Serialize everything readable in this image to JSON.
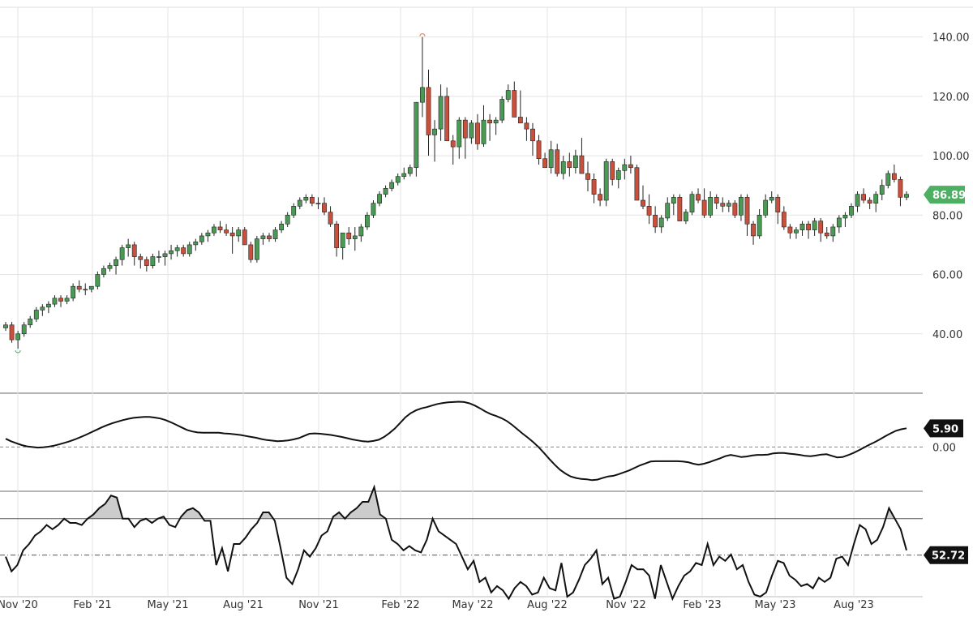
{
  "chart_data": [
    {
      "type": "candlestick",
      "panel": "price",
      "x_ticks": [
        "Nov '20",
        "Feb '21",
        "May '21",
        "Aug '21",
        "Nov '21",
        "Feb '22",
        "May '22",
        "Aug '22",
        "Nov '22",
        "Feb '23",
        "May '23",
        "Aug '23"
      ],
      "y_ticks": [
        "140.00",
        "120.00",
        "100.00",
        "80.00",
        "60.00",
        "40.00"
      ],
      "ylim": [
        20,
        150
      ],
      "grid": true,
      "last_price": "86.89",
      "colors": {
        "up": "#4a9a55",
        "down": "#c8503c",
        "last_badge": "#4caf61"
      },
      "ohlc": [
        [
          42,
          44,
          41,
          43
        ],
        [
          43,
          44,
          37,
          38
        ],
        [
          38,
          41,
          35,
          40
        ],
        [
          40,
          44,
          39,
          43
        ],
        [
          43,
          46,
          42,
          45
        ],
        [
          45,
          49,
          44,
          48
        ],
        [
          48,
          50,
          46,
          49
        ],
        [
          49,
          51,
          47,
          50
        ],
        [
          50,
          53,
          49,
          52
        ],
        [
          52,
          53,
          49,
          51
        ],
        [
          51,
          53,
          50,
          52
        ],
        [
          52,
          57,
          51,
          56
        ],
        [
          56,
          58,
          54,
          55
        ],
        [
          55,
          57,
          53,
          55
        ],
        [
          55,
          56,
          54,
          56
        ],
        [
          56,
          61,
          55,
          60
        ],
        [
          60,
          63,
          59,
          62
        ],
        [
          62,
          64,
          61,
          63
        ],
        [
          63,
          66,
          60,
          65
        ],
        [
          65,
          70,
          63,
          69
        ],
        [
          69,
          72,
          66,
          70
        ],
        [
          70,
          71,
          63,
          66
        ],
        [
          66,
          67,
          62,
          65
        ],
        [
          65,
          66,
          61,
          63
        ],
        [
          63,
          67,
          62,
          66
        ],
        [
          66,
          68,
          64,
          66
        ],
        [
          66,
          68,
          63,
          67
        ],
        [
          67,
          70,
          65,
          68
        ],
        [
          68,
          70,
          66,
          69
        ],
        [
          69,
          70,
          66,
          67
        ],
        [
          67,
          71,
          66,
          70
        ],
        [
          70,
          72,
          68,
          71
        ],
        [
          71,
          74,
          70,
          73
        ],
        [
          73,
          75,
          71,
          74
        ],
        [
          74,
          77,
          73,
          76
        ],
        [
          76,
          78,
          74,
          75
        ],
        [
          75,
          77,
          73,
          74
        ],
        [
          74,
          76,
          67,
          73
        ],
        [
          73,
          76,
          71,
          75
        ],
        [
          75,
          76,
          70,
          70
        ],
        [
          70,
          71,
          64,
          65
        ],
        [
          65,
          73,
          64,
          72
        ],
        [
          72,
          74,
          70,
          73
        ],
        [
          73,
          74,
          71,
          72
        ],
        [
          72,
          76,
          71,
          75
        ],
        [
          75,
          78,
          74,
          77
        ],
        [
          77,
          81,
          76,
          80
        ],
        [
          80,
          84,
          79,
          83
        ],
        [
          83,
          86,
          82,
          85
        ],
        [
          85,
          87,
          84,
          86
        ],
        [
          86,
          87,
          83,
          84
        ],
        [
          84,
          86,
          82,
          84
        ],
        [
          84,
          86,
          80,
          81
        ],
        [
          81,
          83,
          76,
          77
        ],
        [
          77,
          78,
          66,
          69
        ],
        [
          69,
          73,
          65,
          74
        ],
        [
          74,
          76,
          70,
          72
        ],
        [
          72,
          76,
          68,
          73
        ],
        [
          73,
          77,
          71,
          76
        ],
        [
          76,
          81,
          75,
          80
        ],
        [
          80,
          85,
          79,
          84
        ],
        [
          84,
          88,
          83,
          87
        ],
        [
          87,
          90,
          86,
          89
        ],
        [
          89,
          92,
          88,
          91
        ],
        [
          91,
          94,
          90,
          93
        ],
        [
          93,
          96,
          92,
          94
        ],
        [
          94,
          97,
          93,
          96
        ],
        [
          96,
          110,
          93,
          118
        ],
        [
          118,
          140,
          113,
          123
        ],
        [
          123,
          129,
          100,
          107
        ],
        [
          107,
          112,
          98,
          109
        ],
        [
          109,
          124,
          105,
          120
        ],
        [
          120,
          123,
          105,
          105
        ],
        [
          105,
          107,
          97,
          103
        ],
        [
          103,
          113,
          99,
          112
        ],
        [
          112,
          113,
          99,
          106
        ],
        [
          106,
          112,
          104,
          111
        ],
        [
          111,
          114,
          102,
          104
        ],
        [
          104,
          117,
          103,
          112
        ],
        [
          112,
          114,
          105,
          111
        ],
        [
          111,
          113,
          107,
          112
        ],
        [
          112,
          120,
          111,
          119
        ],
        [
          119,
          124,
          118,
          122
        ],
        [
          122,
          125,
          113,
          113
        ],
        [
          113,
          122,
          111,
          111
        ],
        [
          111,
          113,
          105,
          109
        ],
        [
          109,
          111,
          100,
          105
        ],
        [
          105,
          107,
          97,
          99
        ],
        [
          99,
          101,
          96,
          96
        ],
        [
          96,
          105,
          94,
          102
        ],
        [
          102,
          104,
          93,
          94
        ],
        [
          94,
          100,
          92,
          98
        ],
        [
          98,
          101,
          93,
          96
        ],
        [
          96,
          102,
          94,
          100
        ],
        [
          100,
          106,
          94,
          94
        ],
        [
          94,
          98,
          88,
          92
        ],
        [
          92,
          94,
          84,
          87
        ],
        [
          87,
          89,
          83,
          85
        ],
        [
          85,
          99,
          83,
          98
        ],
        [
          98,
          99,
          90,
          92
        ],
        [
          92,
          96,
          89,
          95
        ],
        [
          95,
          99,
          92,
          97
        ],
        [
          97,
          100,
          94,
          96
        ],
        [
          96,
          97,
          85,
          85
        ],
        [
          85,
          90,
          82,
          83
        ],
        [
          83,
          87,
          77,
          80
        ],
        [
          80,
          83,
          74,
          76
        ],
        [
          76,
          80,
          74,
          79
        ],
        [
          79,
          86,
          78,
          84
        ],
        [
          84,
          87,
          80,
          86
        ],
        [
          86,
          87,
          78,
          78
        ],
        [
          78,
          82,
          77,
          81
        ],
        [
          81,
          88,
          80,
          87
        ],
        [
          87,
          89,
          84,
          85
        ],
        [
          85,
          89,
          79,
          80
        ],
        [
          80,
          88,
          79,
          86
        ],
        [
          86,
          87,
          82,
          84
        ],
        [
          84,
          86,
          81,
          83
        ],
        [
          83,
          85,
          81,
          84
        ],
        [
          84,
          85,
          79,
          80
        ],
        [
          80,
          87,
          78,
          86
        ],
        [
          86,
          87,
          73,
          77
        ],
        [
          77,
          78,
          70,
          73
        ],
        [
          73,
          82,
          72,
          80
        ],
        [
          80,
          87,
          79,
          85
        ],
        [
          85,
          88,
          84,
          86
        ],
        [
          86,
          87,
          77,
          81
        ],
        [
          81,
          83,
          75,
          76
        ],
        [
          76,
          77,
          72,
          74
        ],
        [
          74,
          76,
          72,
          75
        ],
        [
          75,
          78,
          73,
          77
        ],
        [
          77,
          78,
          72,
          75
        ],
        [
          75,
          79,
          73,
          78
        ],
        [
          78,
          79,
          71,
          74
        ],
        [
          74,
          76,
          72,
          73
        ],
        [
          73,
          77,
          71,
          76
        ],
        [
          76,
          80,
          74,
          79
        ],
        [
          79,
          81,
          76,
          80
        ],
        [
          80,
          84,
          79,
          83
        ],
        [
          83,
          88,
          81,
          87
        ],
        [
          87,
          89,
          84,
          85
        ],
        [
          85,
          86,
          82,
          84
        ],
        [
          84,
          88,
          81,
          87
        ],
        [
          87,
          92,
          85,
          90
        ],
        [
          90,
          95,
          89,
          94
        ],
        [
          94,
          97,
          91,
          92
        ],
        [
          92,
          93,
          83,
          86
        ],
        [
          86,
          88,
          85,
          87
        ]
      ]
    },
    {
      "type": "line",
      "panel": "oscillator",
      "last_value": "5.90",
      "zero_label": "0.00",
      "ylim": [
        -14,
        17
      ],
      "values": [
        2.6,
        1.8,
        1.2,
        0.6,
        0.2,
        0,
        -0.2,
        -0.1,
        0.1,
        0.4,
        0.8,
        1.3,
        1.8,
        2.4,
        3.1,
        3.8,
        4.6,
        5.4,
        6.2,
        6.9,
        7.5,
        8,
        8.5,
        8.9,
        9.2,
        9.4,
        9.5,
        9.5,
        9.3,
        9,
        8.5,
        7.8,
        7,
        6.2,
        5.4,
        4.9,
        4.6,
        4.5,
        4.5,
        4.5,
        4.5,
        4.3,
        4.2,
        4,
        3.8,
        3.5,
        3.2,
        2.9,
        2.5,
        2.2,
        2,
        1.8,
        1.9,
        2.1,
        2.4,
        2.8,
        3.5,
        4.2,
        4.3,
        4.2,
        4,
        3.8,
        3.5,
        3.2,
        2.8,
        2.4,
        2.1,
        1.8,
        1.7,
        1.9,
        2.3,
        3.2,
        4.4,
        5.8,
        7.6,
        9.4,
        10.7,
        11.6,
        12.2,
        12.6,
        13.1,
        13.6,
        13.9,
        14.1,
        14.2,
        14.3,
        14.2,
        13.8,
        13.1,
        12.2,
        11.2,
        10.4,
        9.8,
        9.1,
        8.2,
        7,
        5.6,
        4.2,
        2.9,
        1.5,
        -0.1,
        -1.9,
        -3.8,
        -5.6,
        -7.2,
        -8.4,
        -9.3,
        -9.8,
        -10.1,
        -10.2,
        -10.5,
        -10.3,
        -9.8,
        -9.3,
        -9.1,
        -8.6,
        -8,
        -7.4,
        -6.6,
        -5.8,
        -5.2,
        -4.6,
        -4.5,
        -4.5,
        -4.5,
        -4.5,
        -4.5,
        -4.6,
        -4.8,
        -5.3,
        -5.6,
        -5.3,
        -4.8,
        -4.2,
        -3.6,
        -2.9,
        -2.5,
        -2.8,
        -3.2,
        -3,
        -2.7,
        -2.5,
        -2.5,
        -2.4,
        -2,
        -1.9,
        -1.9,
        -2.1,
        -2.3,
        -2.5,
        -2.8,
        -2.9,
        -2.7,
        -2.4,
        -2.3,
        -2.8,
        -3.3,
        -3.2,
        -2.6,
        -1.9,
        -1.1,
        -0.2,
        0.7,
        1.5,
        2.4,
        3.4,
        4.3,
        5.1,
        5.6,
        5.9
      ]
    },
    {
      "type": "line",
      "panel": "rsi",
      "last_value": "52.72",
      "upper_band": 70,
      "mid_band": 52.72,
      "ylim": [
        33,
        83
      ],
      "values": [
        52,
        45,
        48,
        55,
        58,
        62,
        64,
        67,
        65,
        67,
        70,
        68,
        68,
        67,
        70,
        72,
        75,
        77,
        81,
        80,
        70,
        70,
        66,
        69,
        70,
        68,
        70,
        71,
        67,
        66,
        71,
        74,
        75,
        73,
        69,
        69,
        48,
        56,
        45,
        58,
        58,
        61,
        65,
        68,
        73,
        73,
        69,
        56,
        42,
        39,
        46,
        55,
        52,
        56,
        62,
        64,
        71,
        73,
        70,
        73,
        75,
        78,
        78,
        85,
        72,
        70,
        60,
        58,
        55,
        57,
        55,
        54,
        60,
        70,
        64,
        62,
        60,
        58,
        52,
        46,
        50,
        40,
        42,
        35,
        38,
        36,
        32,
        37,
        40,
        38,
        34,
        35,
        42,
        37,
        36,
        49,
        33,
        35,
        41,
        48,
        51,
        55,
        39,
        42,
        32,
        33,
        40,
        48,
        46,
        46,
        43,
        32,
        48,
        40,
        32,
        38,
        43,
        45,
        49,
        48,
        58,
        48,
        52,
        50,
        53,
        46,
        48,
        40,
        34,
        33,
        35,
        43,
        50,
        49,
        43,
        41,
        38,
        39,
        37,
        42,
        40,
        42,
        51,
        52,
        48,
        58,
        67,
        65,
        58,
        60,
        66,
        75,
        70,
        65,
        55
      ]
    }
  ]
}
